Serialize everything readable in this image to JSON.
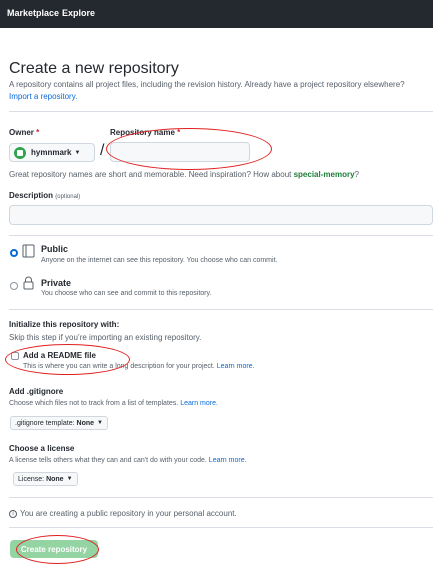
{
  "topbar": {
    "nav": [
      "Marketplace",
      "Explore"
    ]
  },
  "page": {
    "title": "Create a new repository",
    "subtitle": "A repository contains all project files, including the revision history. Already have a project repository elsewhere?",
    "import_link": "Import a repository."
  },
  "owner": {
    "label": "Owner",
    "required_mark": "*",
    "value": "hymnmark",
    "separator": "/"
  },
  "repo_name": {
    "label": "Repository name",
    "required_mark": "*",
    "value": ""
  },
  "name_hint": {
    "text": "Great repository names are short and memorable. Need inspiration? How about ",
    "suggestion": "special-memory",
    "end": "?"
  },
  "description": {
    "label": "Description",
    "optional": "(optional)",
    "value": ""
  },
  "visibility": {
    "public": {
      "title": "Public",
      "desc": "Anyone on the internet can see this repository. You choose who can commit.",
      "selected": true
    },
    "private": {
      "title": "Private",
      "desc": "You choose who can see and commit to this repository.",
      "selected": false
    }
  },
  "initialize": {
    "heading": "Initialize this repository with:",
    "hint": "Skip this step if you’re importing an existing repository.",
    "readme": {
      "label": "Add a README file",
      "desc": "This is where you can write a long description for your project.",
      "link": "Learn more.",
      "checked": false
    }
  },
  "gitignore": {
    "heading": "Add .gitignore",
    "desc": "Choose which files not to track from a list of templates.",
    "link": "Learn more.",
    "dropdown_prefix": ".gitignore template:",
    "dropdown_value": "None"
  },
  "license": {
    "heading": "Choose a license",
    "desc": "A license tells others what they can and can't do with your code.",
    "link": "Learn more.",
    "dropdown_prefix": "License:",
    "dropdown_value": "None"
  },
  "info": {
    "icon": "info-icon",
    "text": "You are creating a public repository in your personal account."
  },
  "submit": {
    "label": "Create repository"
  },
  "colors": {
    "header_bg": "#24292f",
    "primary_button": "#94d3a2",
    "link": "#0969da",
    "annotation": "#e02020",
    "suggestion": "#1a7f37"
  }
}
